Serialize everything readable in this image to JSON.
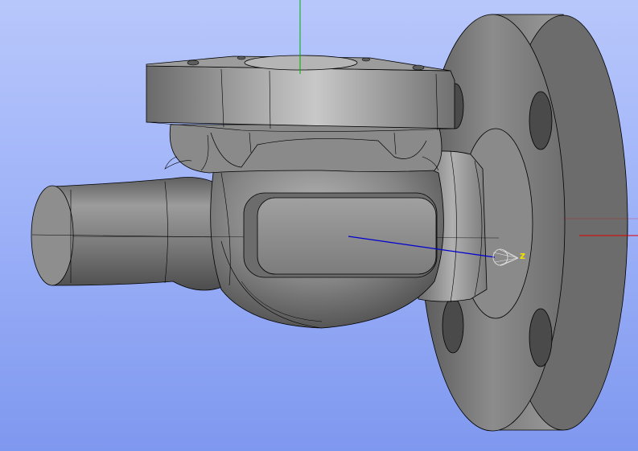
{
  "viewport": {
    "background_top": "#b8c7fb",
    "background_bottom": "#7f98ef"
  },
  "triad": {
    "z_label": "z",
    "x_axis_color": "#e00000",
    "y_axis_color": "#00b000",
    "z_axis_color": "#0000d0",
    "label_color": "#f0e000"
  },
  "model": {
    "surface_color": "#8a8a8a",
    "edge_color": "#000000"
  }
}
